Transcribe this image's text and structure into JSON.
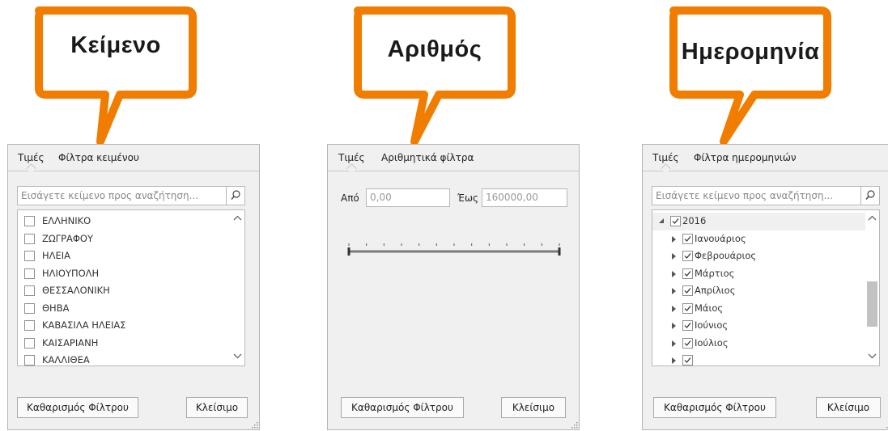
{
  "callouts": [
    {
      "label": "Κείμενο"
    },
    {
      "label": "Αριθμός"
    },
    {
      "label": "Ημερομηνία"
    }
  ],
  "colors": {
    "callout_border": "#f07d00",
    "panel_bg": "#f0f0f0",
    "check": "#2b2b2b"
  },
  "text_panel": {
    "tabs": [
      "Τιμές",
      "Φίλτρα κειμένου"
    ],
    "search_placeholder": "Εισάγετε κείμενο προς αναζήτηση...",
    "items": [
      "ΕΛΛΗΝΙΚΟ",
      "ΖΩΓΡΑΦΟΥ",
      "ΗΛΕΙΑ",
      "ΗΛΙΟΥΠΟΛΗ",
      "ΘΕΣΣΑΛΟΝΙΚΗ",
      "ΘΗΒΑ",
      "ΚΑΒΑΣΙΛΑ ΗΛΕΙΑΣ",
      "ΚΑΙΣΑΡΙΑΝΗ",
      "ΚΑΛΛΙΘΕΑ"
    ],
    "clear_button": "Καθαρισμός Φίλτρου",
    "close_button": "Κλείσιμο"
  },
  "number_panel": {
    "tabs": [
      "Τιμές",
      "Αριθμητικά φίλτρα"
    ],
    "from_label": "Από",
    "from_value": "0,00",
    "to_label": "Έως",
    "to_value": "160000,00",
    "slider_range": [
      0,
      1
    ],
    "clear_button": "Καθαρισμός Φίλτρου",
    "close_button": "Κλείσιμο"
  },
  "date_panel": {
    "tabs": [
      "Τιμές",
      "Φίλτρα ημερομηνιών"
    ],
    "search_placeholder": "Εισάγετε κείμενο προς αναζήτηση...",
    "year": "2016",
    "months": [
      "Ιανουάριος",
      "Φεβρουάριος",
      "Μάρτιος",
      "Απρίλιος",
      "Μάιος",
      "Ιούνιος",
      "Ιούλιος"
    ],
    "clear_button": "Καθαρισμός Φίλτρου",
    "close_button": "Κλείσιμο"
  }
}
